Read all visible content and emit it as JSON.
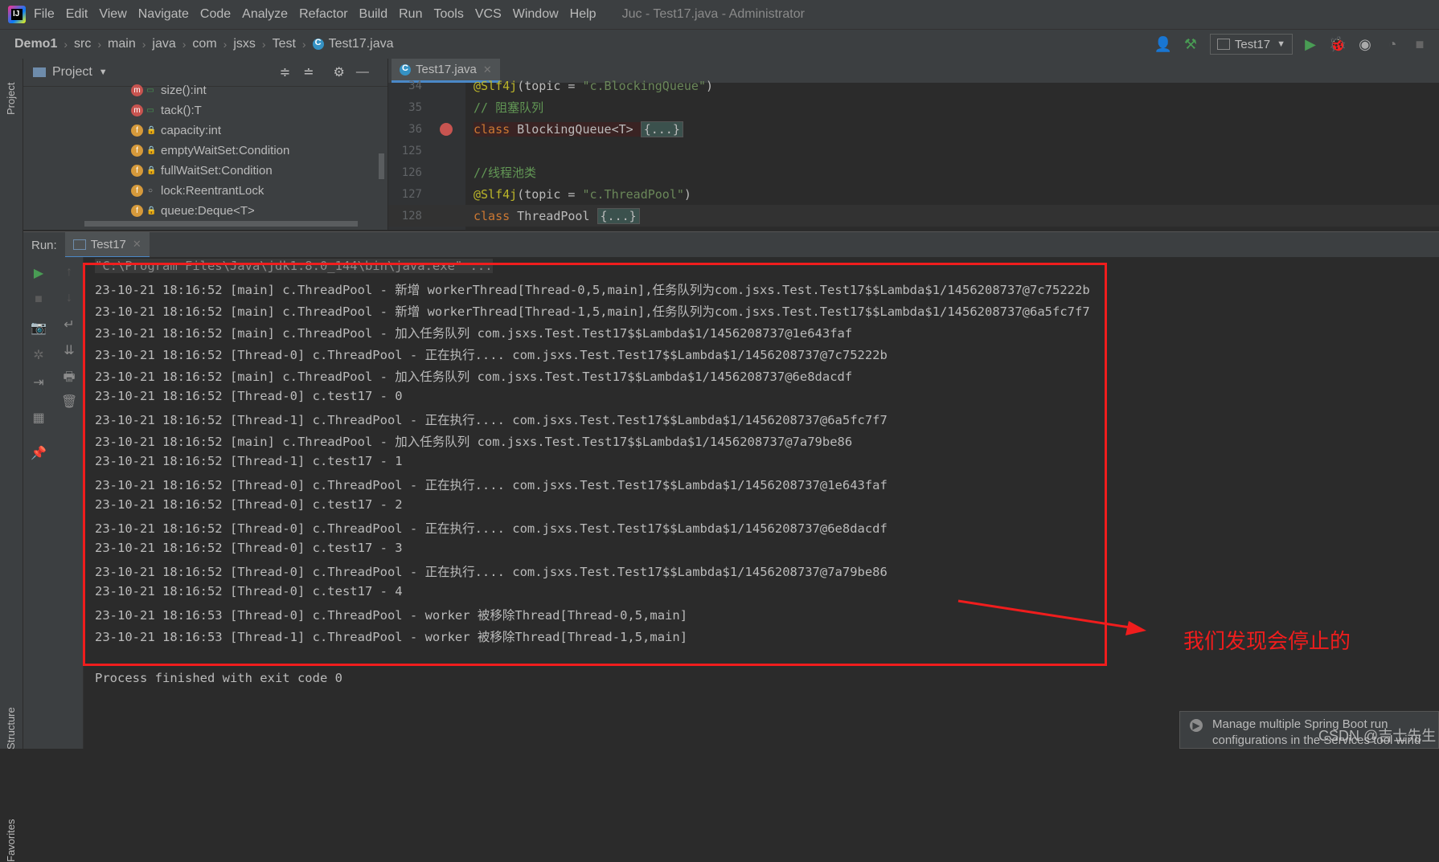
{
  "menubar": {
    "items": [
      "File",
      "Edit",
      "View",
      "Navigate",
      "Code",
      "Analyze",
      "Refactor",
      "Build",
      "Run",
      "Tools",
      "VCS",
      "Window",
      "Help"
    ],
    "window_title": "Juc - Test17.java - Administrator"
  },
  "navbar": {
    "breadcrumbs": [
      "Demo1",
      "src",
      "main",
      "java",
      "com",
      "jsxs",
      "Test",
      "Test17.java"
    ],
    "run_config": "Test17"
  },
  "side_labels": {
    "project": "Project",
    "structure": "Structure",
    "favorites": "Favorites"
  },
  "project_panel": {
    "title": "Project",
    "items": [
      {
        "kind": "m",
        "vis": "open",
        "label": "size():int"
      },
      {
        "kind": "m",
        "vis": "open",
        "label": "tack():T"
      },
      {
        "kind": "f",
        "vis": "lock",
        "label": "capacity:int"
      },
      {
        "kind": "f",
        "vis": "lock",
        "label": "emptyWaitSet:Condition"
      },
      {
        "kind": "f",
        "vis": "lock",
        "label": "fullWaitSet:Condition"
      },
      {
        "kind": "f",
        "vis": "circle",
        "label": "lock:ReentrantLock"
      },
      {
        "kind": "f",
        "vis": "lock",
        "label": "queue:Deque<T>"
      }
    ]
  },
  "editor": {
    "tab": "Test17.java",
    "lines": [
      {
        "num": "34",
        "html_key": "l34"
      },
      {
        "num": "35",
        "html_key": "l35"
      },
      {
        "num": "36",
        "html_key": "l36"
      },
      {
        "num": "125",
        "html_key": "l125"
      },
      {
        "num": "126",
        "html_key": "l126"
      },
      {
        "num": "127",
        "html_key": "l127"
      },
      {
        "num": "128",
        "html_key": "l128"
      }
    ],
    "code": {
      "l34_ann": "@Slf4j",
      "l34_rest": "(topic = ",
      "l34_str": "\"c.BlockingQueue\"",
      "l34_end": ")",
      "l35": "// 阻塞队列",
      "l36_kw": "class",
      "l36_name": " BlockingQueue<T> ",
      "l36_fold": "{...}",
      "l126": "//线程池类",
      "l127_ann": "@Slf4j",
      "l127_rest": "(topic = ",
      "l127_str": "\"c.ThreadPool\"",
      "l127_end": ")",
      "l128_kw": "class",
      "l128_name": " ThreadPool ",
      "l128_fold": "{...}"
    }
  },
  "run": {
    "label": "Run:",
    "tab": "Test17",
    "command": "\"C:\\Program Files\\Java\\jdk1.8.0_144\\bin\\java.exe\" ...",
    "output": [
      "23-10-21 18:16:52 [main] c.ThreadPool - 新增 workerThread[Thread-0,5,main],任务队列为com.jsxs.Test.Test17$$Lambda$1/1456208737@7c75222b",
      "23-10-21 18:16:52 [main] c.ThreadPool - 新增 workerThread[Thread-1,5,main],任务队列为com.jsxs.Test.Test17$$Lambda$1/1456208737@6a5fc7f7",
      "23-10-21 18:16:52 [main] c.ThreadPool - 加入任务队列 com.jsxs.Test.Test17$$Lambda$1/1456208737@1e643faf",
      "23-10-21 18:16:52 [Thread-0] c.ThreadPool - 正在执行.... com.jsxs.Test.Test17$$Lambda$1/1456208737@7c75222b",
      "23-10-21 18:16:52 [main] c.ThreadPool - 加入任务队列 com.jsxs.Test.Test17$$Lambda$1/1456208737@6e8dacdf",
      "23-10-21 18:16:52 [Thread-0] c.test17 - 0",
      "23-10-21 18:16:52 [Thread-1] c.ThreadPool - 正在执行.... com.jsxs.Test.Test17$$Lambda$1/1456208737@6a5fc7f7",
      "23-10-21 18:16:52 [main] c.ThreadPool - 加入任务队列 com.jsxs.Test.Test17$$Lambda$1/1456208737@7a79be86",
      "23-10-21 18:16:52 [Thread-1] c.test17 - 1",
      "23-10-21 18:16:52 [Thread-0] c.ThreadPool - 正在执行.... com.jsxs.Test.Test17$$Lambda$1/1456208737@1e643faf",
      "23-10-21 18:16:52 [Thread-0] c.test17 - 2",
      "23-10-21 18:16:52 [Thread-0] c.ThreadPool - 正在执行.... com.jsxs.Test.Test17$$Lambda$1/1456208737@6e8dacdf",
      "23-10-21 18:16:52 [Thread-0] c.test17 - 3",
      "23-10-21 18:16:52 [Thread-0] c.ThreadPool - 正在执行.... com.jsxs.Test.Test17$$Lambda$1/1456208737@7a79be86",
      "23-10-21 18:16:52 [Thread-0] c.test17 - 4",
      "23-10-21 18:16:53 [Thread-0] c.ThreadPool - worker 被移除Thread[Thread-0,5,main]",
      "23-10-21 18:16:53 [Thread-1] c.ThreadPool - worker 被移除Thread[Thread-1,5,main]"
    ],
    "exit": "Process finished with exit code 0"
  },
  "annotation": "我们发现会停止的",
  "notification": {
    "line1": "Manage multiple Spring Boot run",
    "line2": "configurations in the Services tool wind"
  },
  "watermark": "CSDN @吉士先生",
  "colors": {
    "accent": "#4a88c7",
    "annotation": "#f01d1d",
    "run_green": "#499c54"
  }
}
